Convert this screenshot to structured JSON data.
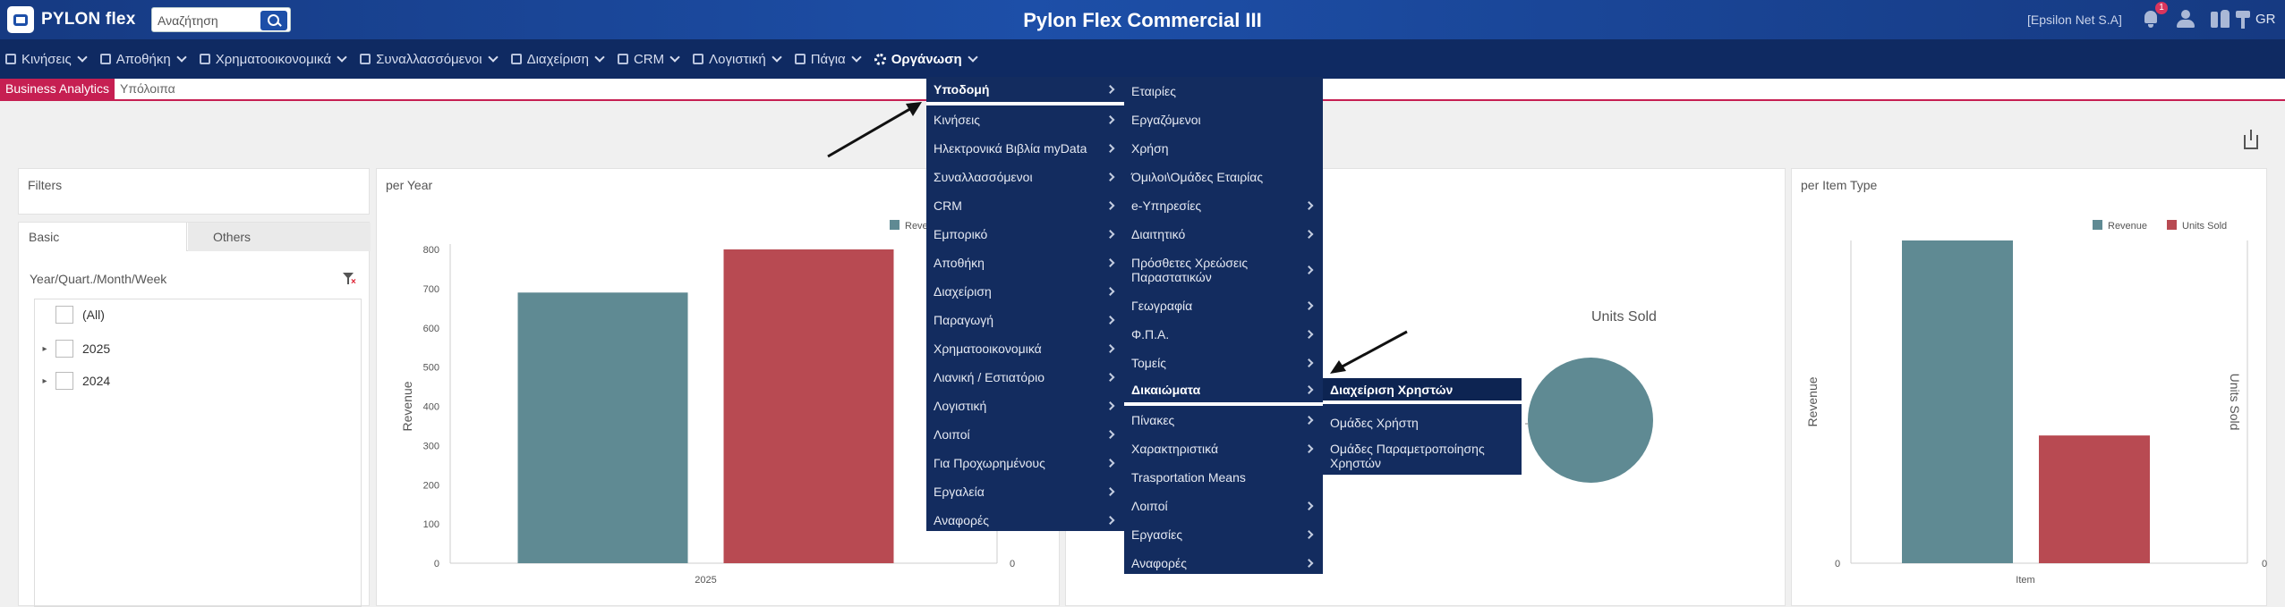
{
  "app": {
    "logo_text": "PYLON flex",
    "title": "Pylon Flex Commercial III",
    "company": "[Epsilon Net S.A]",
    "notification_count": "1",
    "language": "GR"
  },
  "search": {
    "placeholder": "Αναζήτηση"
  },
  "menubar": {
    "items": [
      {
        "label": "Κινήσεις",
        "icon": "list-icon"
      },
      {
        "label": "Αποθήκη",
        "icon": "warehouse-icon"
      },
      {
        "label": "Χρηματοοικονομικά",
        "icon": "finance-icon"
      },
      {
        "label": "Συναλλασσόμενοι",
        "icon": "people-icon"
      },
      {
        "label": "Διαχείριση",
        "icon": "document-icon"
      },
      {
        "label": "CRM",
        "icon": "crm-icon"
      },
      {
        "label": "Λογιστική",
        "icon": "accounting-icon"
      },
      {
        "label": "Πάγια",
        "icon": "truck-icon"
      },
      {
        "label": "Οργάνωση",
        "icon": "gear-icon"
      }
    ]
  },
  "tabs": {
    "active": "Business Analytics",
    "other": "Υπόλοιπα"
  },
  "filters": {
    "title": "Filters",
    "tab_basic": "Basic",
    "tab_others": "Others",
    "group_label": "Year/Quart./Month/Week",
    "tree": [
      "(All)",
      "2025",
      "2024"
    ]
  },
  "menu_level1": {
    "items": [
      "Υποδομή",
      "Κινήσεις",
      "Ηλεκτρονικά Βιβλία myData",
      "Συναλλασσόμενοι",
      "CRM",
      "Εμπορικό",
      "Αποθήκη",
      "Διαχείριση",
      "Παραγωγή",
      "Χρηματοοικονομικά",
      "Λιανική / Εστιατόριο",
      "Λογιστική",
      "Λοιποί",
      "Για Προχωρημένους",
      "Εργαλεία",
      "Αναφορές"
    ]
  },
  "menu_level2": {
    "items": [
      "Εταιρίες",
      "Εργαζόμενοι",
      "Χρήση",
      "Όμιλοι\\Ομάδες Εταιρίας",
      "e-Υπηρεσίες",
      "Διαιτητικό",
      "Πρόσθετες Χρεώσεις Παραστατικών",
      "Γεωγραφία",
      "Φ.Π.Α.",
      "Τομείς",
      "Δικαιώματα",
      "Πίνακες",
      "Χαρακτηριστικά",
      "Trasportation Means",
      "Λοιποί",
      "Εργασίες",
      "Αναφορές"
    ]
  },
  "menu_level3": {
    "items": [
      "Διαχείριση Χρηστών",
      "Ομάδες Χρήστη",
      "Ομάδες Παραμετροποίησης Χρηστών"
    ]
  },
  "colors": {
    "revenue": "#5f8a93",
    "units_sold": "#b84a52",
    "menu_bg": "#132c5f",
    "accent": "#c61f52"
  },
  "chart_data": [
    {
      "type": "bar",
      "title": "per Year",
      "categories": [
        "2025"
      ],
      "series": [
        {
          "name": "Revenue",
          "values": [
            690
          ]
        },
        {
          "name": "Units Sold",
          "values": [
            800
          ]
        }
      ],
      "ylabel": "Revenue",
      "ylim": [
        0,
        800
      ],
      "yticks": [
        "0",
        "100",
        "200",
        "300",
        "400",
        "500",
        "600",
        "700",
        "800"
      ],
      "y2ticks": [
        "0"
      ],
      "legend": "top-right",
      "legend_visible": [
        "Reve"
      ]
    },
    {
      "type": "pie",
      "title": "Units Sold",
      "series": [
        {
          "name": "Units Sold",
          "values": [
            1
          ]
        }
      ]
    },
    {
      "type": "bar",
      "title": "per Item Type",
      "categories": [
        "Item"
      ],
      "series": [
        {
          "name": "Revenue",
          "values": [
            690
          ]
        },
        {
          "name": "Units Sold",
          "values": [
            300
          ]
        }
      ],
      "ylabel": "Revenue",
      "y2label": "Units Sold",
      "yticks": [
        "0"
      ],
      "y2ticks": [
        "0"
      ],
      "legend": "top-right"
    }
  ]
}
